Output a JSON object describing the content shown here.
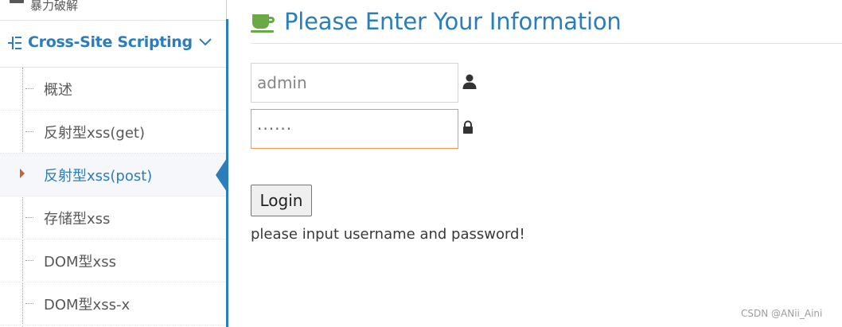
{
  "sidebar": {
    "previous_item": {
      "label": "暴力破解",
      "icon": "list-icon"
    },
    "group": {
      "label": "Cross-Site Scripting",
      "icon": "tree-icon",
      "expand_icon": "chevron-down-icon"
    },
    "items": [
      {
        "label": "概述",
        "active": false
      },
      {
        "label": "反射型xss(get)",
        "active": false
      },
      {
        "label": "反射型xss(post)",
        "active": true
      },
      {
        "label": "存储型xss",
        "active": false
      },
      {
        "label": "DOM型xss",
        "active": false
      },
      {
        "label": "DOM型xss-x",
        "active": false
      }
    ]
  },
  "main": {
    "title": "Please Enter Your Information",
    "title_icon": "coffee-icon",
    "username": {
      "value": "admin",
      "icon": "user-icon"
    },
    "password": {
      "value": "······",
      "icon": "lock-icon"
    },
    "login_label": "Login",
    "message": "please input username and password!"
  },
  "watermark": "CSDN @ANii_Aini",
  "colors": {
    "accent": "#2b7dbc",
    "focus_border": "#f59942",
    "active_caret": "#c86139",
    "icon_green": "#69aa46"
  }
}
